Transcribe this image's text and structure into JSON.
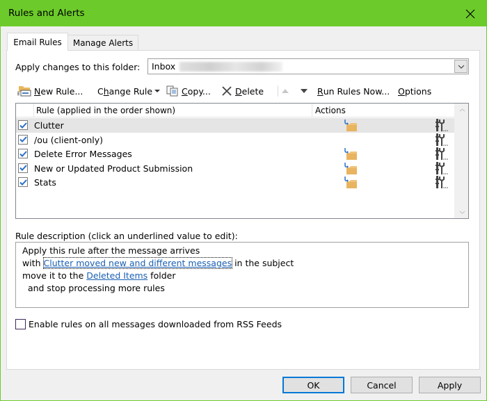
{
  "window": {
    "title": "Rules and Alerts",
    "accent_color": "#6ccb2a"
  },
  "tabs": [
    {
      "label": "Email Rules",
      "active": true
    },
    {
      "label": "Manage Alerts",
      "active": false
    }
  ],
  "folder": {
    "label": "Apply changes to this folder:",
    "value": "Inbox"
  },
  "toolbar": {
    "new_rule": {
      "pre": "",
      "ul": "N",
      "post": "ew Rule..."
    },
    "change_rule": {
      "pre": "C",
      "ul": "h",
      "post": "ange Rule"
    },
    "copy": {
      "pre": "",
      "ul": "C",
      "post": "opy..."
    },
    "delete": {
      "pre": "",
      "ul": "D",
      "post": "elete"
    },
    "run_rules": {
      "pre": "",
      "ul": "R",
      "post": "un Rules Now..."
    },
    "options": {
      "pre": "",
      "ul": "O",
      "post": "ptions"
    }
  },
  "rules_list": {
    "columns": {
      "rule": "Rule (applied in the order shown)",
      "actions": "Actions"
    },
    "rows": [
      {
        "name": "Clutter",
        "checked": true,
        "selected": true,
        "move_action": true
      },
      {
        "name": "/ou  (client-only)",
        "checked": true,
        "selected": false,
        "move_action": false
      },
      {
        "name": "Delete Error Messages",
        "checked": true,
        "selected": false,
        "move_action": true
      },
      {
        "name": "New or Updated Product Submission",
        "checked": true,
        "selected": false,
        "move_action": true
      },
      {
        "name": "Stats",
        "checked": true,
        "selected": false,
        "move_action": true
      }
    ]
  },
  "description": {
    "label": "Rule description (click an underlined value to edit):",
    "lines": {
      "l1": "Apply this rule after the message arrives",
      "l2_pre": "with ",
      "l2_link": "Clutter moved new and different messages",
      "l2_post": " in the subject",
      "l3_pre": "move it to the ",
      "l3_link": "Deleted Items",
      "l3_post": " folder",
      "l4": "  and stop processing more rules"
    }
  },
  "rss": {
    "label": "Enable rules on all messages downloaded from RSS Feeds",
    "checked": false
  },
  "buttons": {
    "ok": "OK",
    "cancel": "Cancel",
    "apply": "Apply"
  }
}
